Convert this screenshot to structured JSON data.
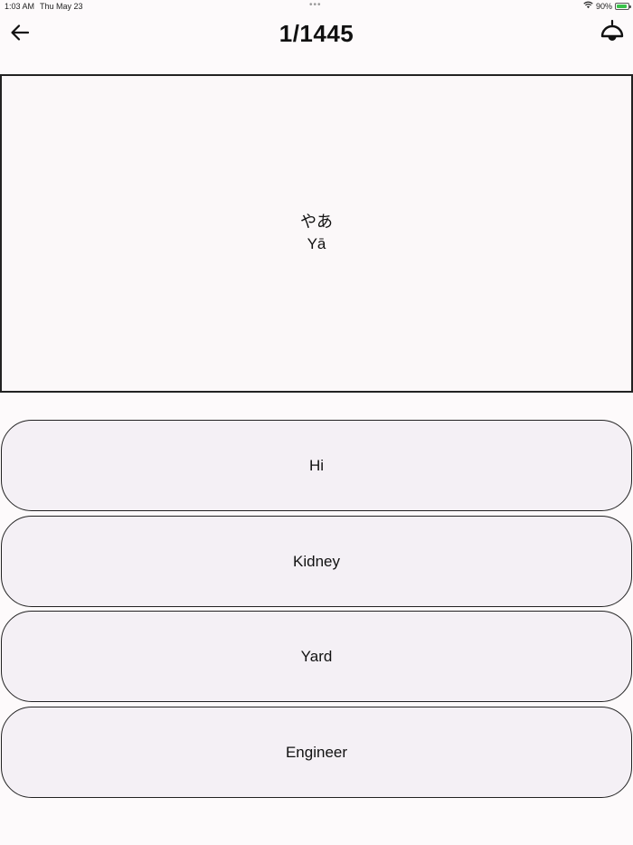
{
  "status_bar": {
    "time": "1:03 AM",
    "date": "Thu May 23",
    "dots": "•••",
    "battery_text": "90%",
    "battery_level": 0.9,
    "wifi_icon": "wifi-icon",
    "battery_color": "#39c24a"
  },
  "header": {
    "back_icon": "arrow-left-icon",
    "title": "1/1445",
    "sound_icon": "bell-icon"
  },
  "card": {
    "word": "やあ",
    "romaji": "Yā"
  },
  "options": [
    {
      "label": "Hi"
    },
    {
      "label": "Kidney"
    },
    {
      "label": "Yard"
    },
    {
      "label": "Engineer"
    }
  ]
}
